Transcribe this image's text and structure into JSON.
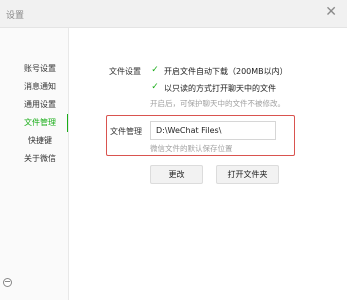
{
  "window": {
    "title": "设置",
    "close_glyph": "✕"
  },
  "sidebar": {
    "items": [
      {
        "label": "账号设置"
      },
      {
        "label": "消息通知"
      },
      {
        "label": "通用设置"
      },
      {
        "label": "文件管理"
      },
      {
        "label": "快捷键"
      },
      {
        "label": "关于微信"
      }
    ],
    "active_index": 3
  },
  "settings": {
    "file_settings_label": "文件设置",
    "auto_download_label": "开启文件自动下载（200MB以内）",
    "auto_download_checked": true,
    "readonly_open_label": "以只读的方式打开聊天中的文件",
    "readonly_open_checked": true,
    "readonly_hint": "开启后，可保护聊天中的文件不被修改。",
    "file_manage_label": "文件管理",
    "path_value": "D:\\WeChat Files\\",
    "path_hint": "微信文件的默认保存位置",
    "change_button": "更改",
    "open_folder_button": "打开文件夹"
  },
  "colors": {
    "accent": "#1aad19",
    "highlight_box": "#d9534f"
  }
}
